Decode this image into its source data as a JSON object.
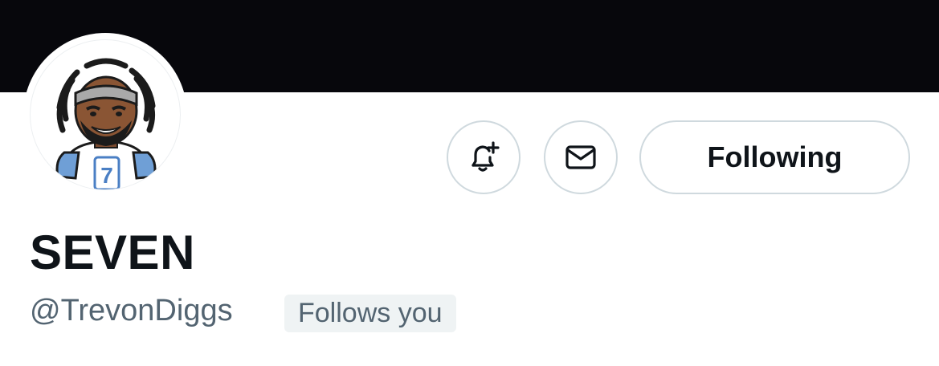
{
  "profile": {
    "display_name": "SEVEN",
    "handle": "@TrevonDiggs",
    "follows_you_label": "Follows you",
    "avatar_jersey_number": "7"
  },
  "actions": {
    "notify_icon": "bell-plus-icon",
    "message_icon": "envelope-icon",
    "following_label": "Following"
  },
  "colors": {
    "banner": "#07070c",
    "text_primary": "#0f1419",
    "text_secondary": "#536471",
    "border": "#cfd9de",
    "badge_bg": "#eff3f4"
  }
}
